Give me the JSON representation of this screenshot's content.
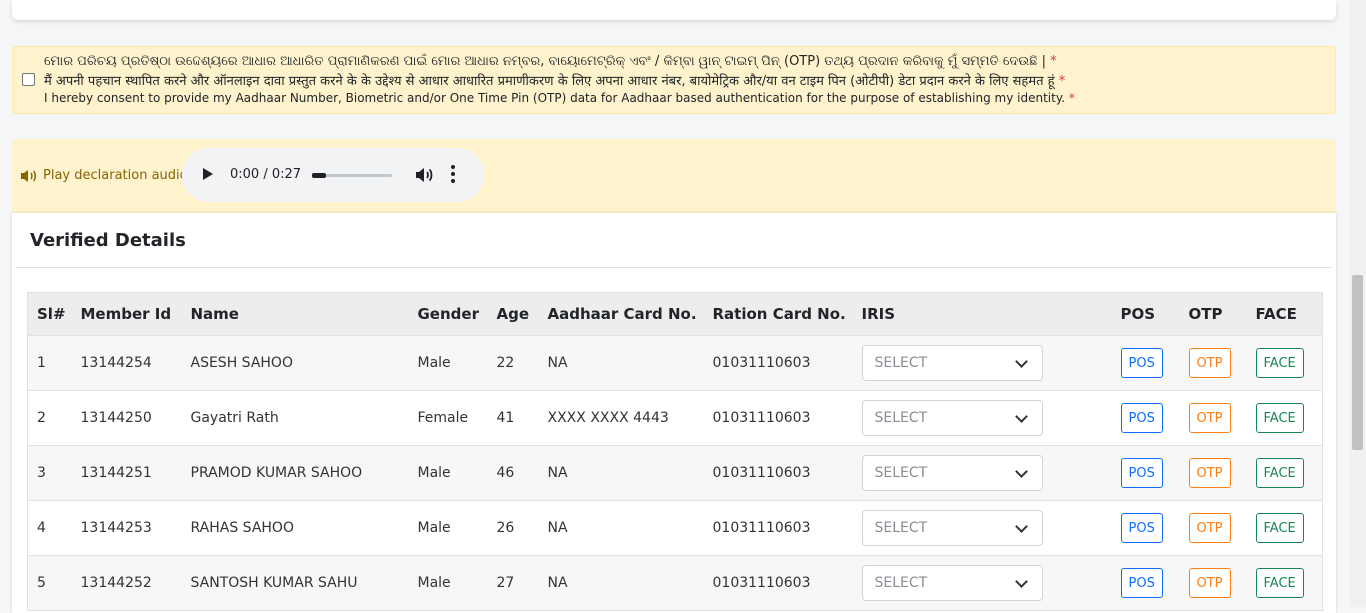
{
  "consent": {
    "odia": "ମୋର ପରିଚୟ ପ୍ରତିଷ୍ଠା ଉଦ୍ଦେଶ୍ୟରେ ଆଧାର ଆଧାରିତ ପ୍ରାମାଣିକରଣ ପାଇଁ ମୋର ଆଧାର ନମ୍ବର, ବାୟୋମେଟ୍ରିକ୍ ଏବଂ / କିମ୍ବା ୱାନ୍ ଟାଇମ୍ ପିନ୍ (OTP) ତଥ୍ୟ ପ୍ରଦାନ କରିବାକୁ ମୁଁ ସମ୍ମତି ଦେଉଛି |",
    "hindi": "मैं अपनी पहचान स्थापित करने और ऑनलाइन दावा प्रस्तुत करने के के उद्देश्य से आधार आधारित प्रमाणीकरण के लिए अपना आधार नंबर, बायोमेट्रिक और/या वन टाइम पिन (ओटीपी) डेटा प्रदान करने के लिए सहमत हूं",
    "english": "I hereby consent to provide my Aadhaar Number, Biometric and/or One Time Pin (OTP) data for Aadhaar based authentication for the purpose of establishing my identity.",
    "required_mark": "*"
  },
  "audio": {
    "label": "Play declaration audio.",
    "time": "0:00 / 0:27",
    "progress": 0
  },
  "details": {
    "title": "Verified Details",
    "columns": [
      "Sl#",
      "Member Id",
      "Name",
      "Gender",
      "Age",
      "Aadhaar Card No.",
      "Ration Card No.",
      "IRIS",
      "POS",
      "OTP",
      "FACE"
    ],
    "select_placeholder": "SELECT",
    "btn_pos": "POS",
    "btn_otp": "OTP",
    "btn_face": "FACE",
    "rows": [
      {
        "sl": "1",
        "member_id": "13144254",
        "name": "ASESH SAHOO",
        "gender": "Male",
        "age": "22",
        "aadhaar": "NA",
        "ration": "01031110603"
      },
      {
        "sl": "2",
        "member_id": "13144250",
        "name": "Gayatri Rath",
        "gender": "Female",
        "age": "41",
        "aadhaar": "XXXX XXXX 4443",
        "ration": "01031110603"
      },
      {
        "sl": "3",
        "member_id": "13144251",
        "name": "PRAMOD KUMAR SAHOO",
        "gender": "Male",
        "age": "46",
        "aadhaar": "NA",
        "ration": "01031110603"
      },
      {
        "sl": "4",
        "member_id": "13144253",
        "name": "RAHAS SAHOO",
        "gender": "Male",
        "age": "26",
        "aadhaar": "NA",
        "ration": "01031110603"
      },
      {
        "sl": "5",
        "member_id": "13144252",
        "name": "SANTOSH KUMAR SAHU",
        "gender": "Male",
        "age": "27",
        "aadhaar": "NA",
        "ration": "01031110603"
      }
    ]
  }
}
